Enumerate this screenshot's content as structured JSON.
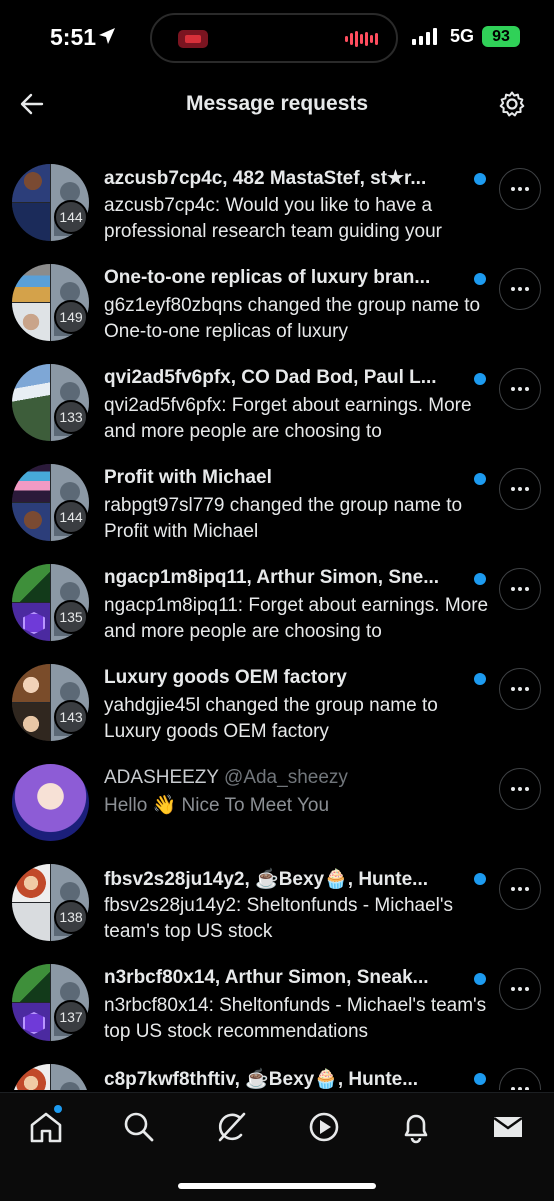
{
  "status_bar": {
    "time": "5:51",
    "network": "5G",
    "battery": "93"
  },
  "header": {
    "title": "Message requests"
  },
  "rows": [
    {
      "title": "azcusb7cp4c, 482 MastaStef, st★r...",
      "preview": "azcusb7cp4c: Would you like to have a professional research team guiding your",
      "count": "144",
      "unread": true
    },
    {
      "title": "One-to-one replicas of luxury bran...",
      "preview": "g6z1eyf80zbqns changed the group name to One-to-one replicas of luxury",
      "count": "149",
      "unread": true
    },
    {
      "title": "qvi2ad5fv6pfx, CO Dad Bod, Paul L...",
      "preview": "qvi2ad5fv6pfx: Forget about earnings. More and more people are choosing to",
      "count": "133",
      "unread": true
    },
    {
      "title": "Profit with Michael",
      "preview": "rabpgt97sl779 changed the group name to Profit with Michael",
      "count": "144",
      "unread": true
    },
    {
      "title": "ngacp1m8ipq11, Arthur Simon, Sne...",
      "preview": "ngacp1m8ipq11: Forget about earnings. More and more people are choosing to",
      "count": "135",
      "unread": true
    },
    {
      "title": "Luxury goods OEM factory",
      "preview": "yahdgjie45l changed the group name to Luxury goods OEM factory",
      "count": "143",
      "unread": true
    },
    {
      "title": "ADASHEEZY",
      "handle": "@Ada_sheezy",
      "preview": "Hello 👋 Nice To Meet You",
      "unread": false
    },
    {
      "title": "fbsv2s28ju14y2, ☕Bexy🧁, Hunte...",
      "preview": "fbsv2s28ju14y2: Sheltonfunds - Michael's team's top US stock",
      "count": "138",
      "unread": true
    },
    {
      "title": "n3rbcf80x14, Arthur Simon, Sneak...",
      "preview": "n3rbcf80x14: Sheltonfunds - Michael's team's top US stock recommendations",
      "count": "137",
      "unread": true
    },
    {
      "title": "c8p7kwf8thftiv, ☕Bexy🧁, Hunte...",
      "preview": "",
      "unread": true
    }
  ],
  "icons": {
    "back": "arrow-left-icon",
    "settings": "gear-icon",
    "more": "more-horizontal-icon",
    "nav": [
      "home-icon",
      "search-icon",
      "grok-icon",
      "video-play-icon",
      "bell-icon",
      "mail-icon"
    ]
  },
  "colors": {
    "accent": "#1d9bf0",
    "background": "#000000",
    "battery": "#30d158"
  }
}
